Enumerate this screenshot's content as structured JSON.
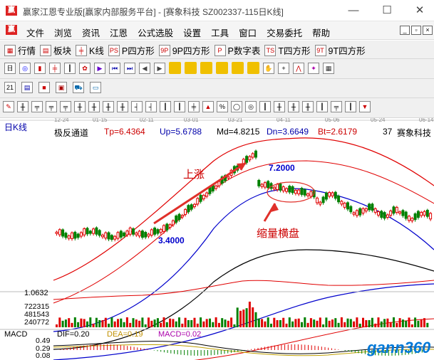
{
  "window": {
    "title": "赢家江恩专业版[赢家内部服务平台] - [赛象科技 SZ002337-115日K线]",
    "minimize": "—",
    "maximize": "☐",
    "close": "✕"
  },
  "menu": {
    "items": [
      "文件",
      "浏览",
      "资讯",
      "江恩",
      "公式选股",
      "设置",
      "工具",
      "窗口",
      "交易委托",
      "帮助"
    ]
  },
  "toolbar1": {
    "items": [
      "行情",
      "板块",
      "K线",
      "P四方形",
      "9P四方形",
      "P数字表",
      "T四方形",
      "9T四方形"
    ]
  },
  "chart": {
    "stock_name": "赛象科技",
    "period_label": "日K线",
    "dates": [
      "12-24",
      "01-15",
      "02-11",
      "03-01",
      "03-21",
      "04-11",
      "05-06",
      "05-24",
      "06-14"
    ],
    "indicator": {
      "name": "极反通道",
      "tp": "Tp=6.4364",
      "up": "Up=5.6788",
      "md": "Md=4.8215",
      "dn": "Dn=3.6649",
      "bt": "Bt=2.6179",
      "num": "37"
    },
    "high_label": "7.2000",
    "low_label": "3.4000",
    "annot_up": "上涨",
    "annot_consol": "缩量横盘",
    "volume": {
      "ratio": "1.0632",
      "levels": [
        "722315",
        "481543",
        "240772"
      ]
    },
    "macd": {
      "name": "MACD",
      "dif": "DIF=0.20",
      "dea": "DEA=0.19",
      "macd": "MACD=0.02",
      "levels": [
        "0.49",
        "0.29",
        "0.08"
      ]
    },
    "watermark": "gann360"
  },
  "colors": {
    "up": "#e00000",
    "down": "#008000",
    "upper_band": "#e00000",
    "mid_band": "#0000cc",
    "center": "#000000",
    "arrow": "#e0302a",
    "blue_text": "#0000cc",
    "red_text": "#cc0000"
  }
}
